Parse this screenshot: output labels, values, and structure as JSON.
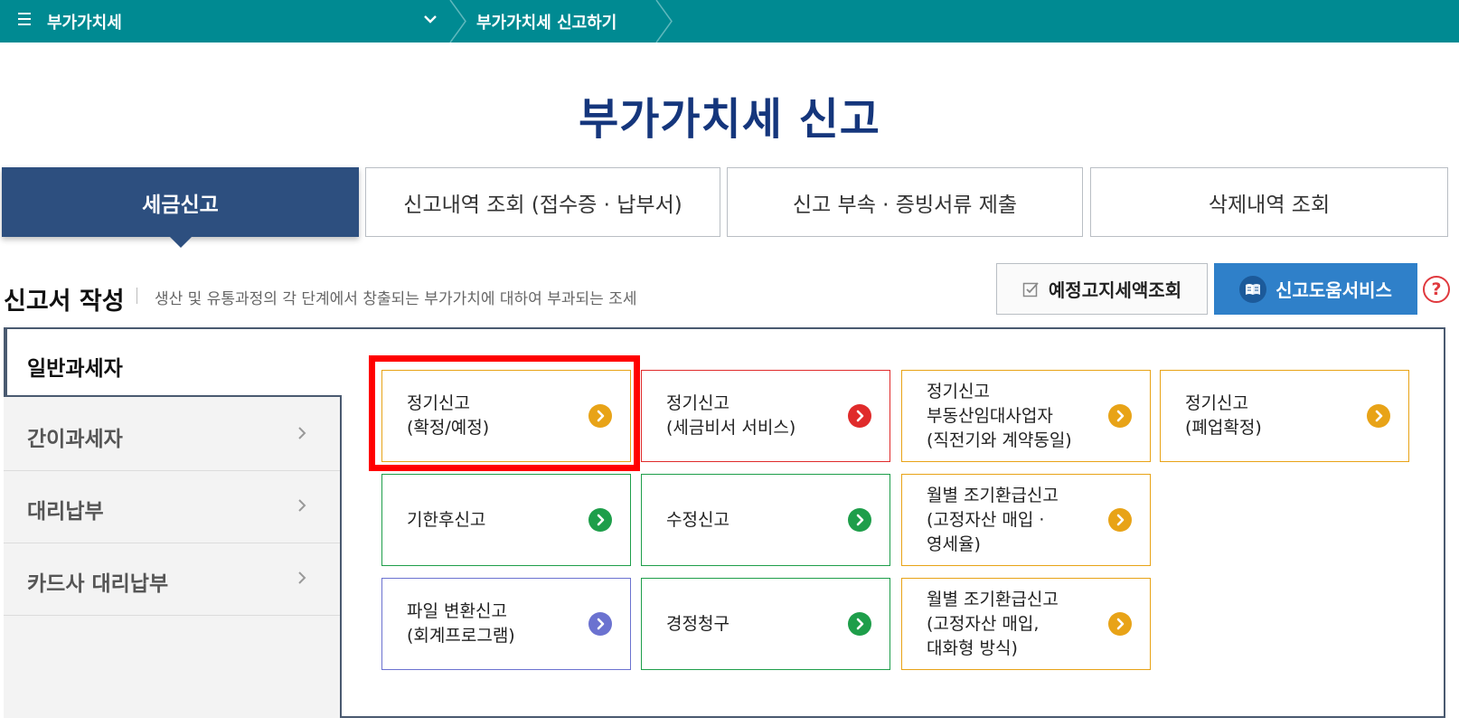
{
  "breadcrumb": {
    "menu": "부가가치세",
    "current": "부가가치세 신고하기"
  },
  "page_title": "부가가치세 신고",
  "tabs": [
    {
      "label": "세금신고",
      "active": true
    },
    {
      "label": "신고내역 조회 (접수증 · 납부서)",
      "active": false
    },
    {
      "label": "신고 부속 · 증빙서류 제출",
      "active": false
    },
    {
      "label": "삭제내역 조회",
      "active": false
    }
  ],
  "section": {
    "title": "신고서 작성",
    "description": "생산 및 유통과정의 각 단계에서 창출되는 부가가치에 대하여 부과되는 조세",
    "estimate_button": "예정고지세액조회",
    "help_button": "신고도움서비스",
    "help_icon": "?"
  },
  "sidebar": {
    "items": [
      {
        "label": "일반과세자",
        "active": true
      },
      {
        "label": "간이과세자",
        "active": false
      },
      {
        "label": "대리납부",
        "active": false
      },
      {
        "label": "카드사 대리납부",
        "active": false
      }
    ]
  },
  "cards": [
    {
      "lines": [
        "정기신고",
        "(확정/예정)"
      ],
      "color": "#e8a317",
      "highlighted": true
    },
    {
      "lines": [
        "정기신고",
        "(세금비서 서비스)"
      ],
      "color": "#e02b2b",
      "highlighted": false
    },
    {
      "lines": [
        "정기신고",
        "부동산임대사업자",
        "(직전기와 계약동일)"
      ],
      "color": "#e8a317",
      "highlighted": false
    },
    {
      "lines": [
        "정기신고",
        "(폐업확정)"
      ],
      "color": "#e8a317",
      "highlighted": false
    },
    {
      "lines": [
        "기한후신고"
      ],
      "color": "#1e9e4a",
      "highlighted": false
    },
    {
      "lines": [
        "수정신고"
      ],
      "color": "#1e9e4a",
      "highlighted": false
    },
    {
      "lines": [
        "월별 조기환급신고",
        "(고정자산 매입 ·",
        "영세율)"
      ],
      "color": "#e8a317",
      "highlighted": false
    },
    {
      "lines": [
        "파일 변환신고",
        "(회계프로그램)"
      ],
      "color": "#6b72d0",
      "highlighted": false
    },
    {
      "lines": [
        "경정청구"
      ],
      "color": "#1e9e4a",
      "highlighted": false
    },
    {
      "lines": [
        "월별 조기환급신고",
        "(고정자산 매입,",
        "대화형 방식)"
      ],
      "color": "#e8a317",
      "highlighted": false
    }
  ]
}
